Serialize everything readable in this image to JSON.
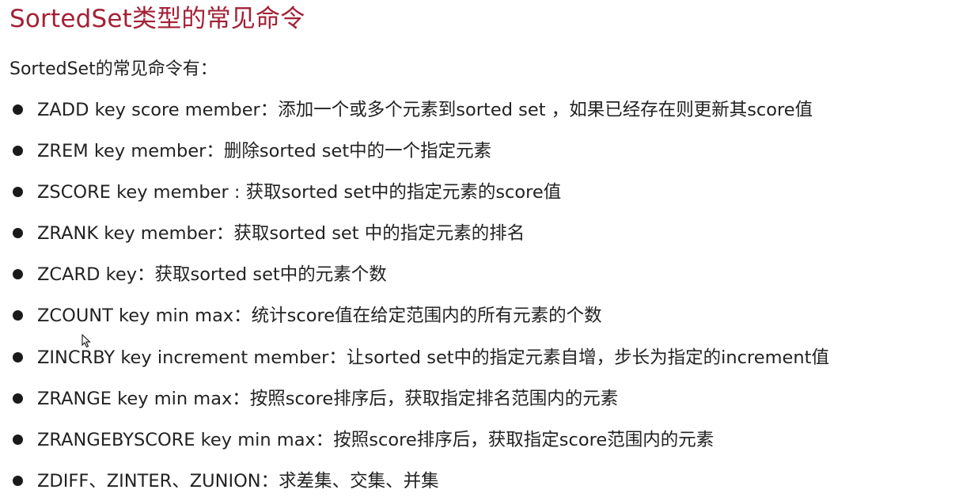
{
  "slide": {
    "title": "SortedSet类型的常见命令",
    "intro": "SortedSet的常见命令有：",
    "items": [
      {
        "text": "ZADD key score member：添加一个或多个元素到sorted set ，如果已经存在则更新其score值"
      },
      {
        "text": "ZREM key member：删除sorted set中的一个指定元素"
      },
      {
        "text": "ZSCORE key member : 获取sorted set中的指定元素的score值"
      },
      {
        "text": "ZRANK key member：获取sorted set 中的指定元素的排名"
      },
      {
        "text": "ZCARD key：获取sorted set中的元素个数"
      },
      {
        "text": "ZCOUNT key min max：统计score值在给定范围内的所有元素的个数"
      },
      {
        "text": "ZINCRBY key increment member：让sorted set中的指定元素自增，步长为指定的increment值"
      },
      {
        "text": "ZRANGE key min max：按照score排序后，获取指定排名范围内的元素"
      },
      {
        "text": "ZRANGEBYSCORE key min max：按照score排序后，获取指定score范围内的元素"
      },
      {
        "text": "ZDIFF、ZINTER、ZUNION：求差集、交集、并集"
      }
    ]
  },
  "colors": {
    "title": "#a32136",
    "text": "#222222",
    "bullet": "#1a1a1a"
  }
}
